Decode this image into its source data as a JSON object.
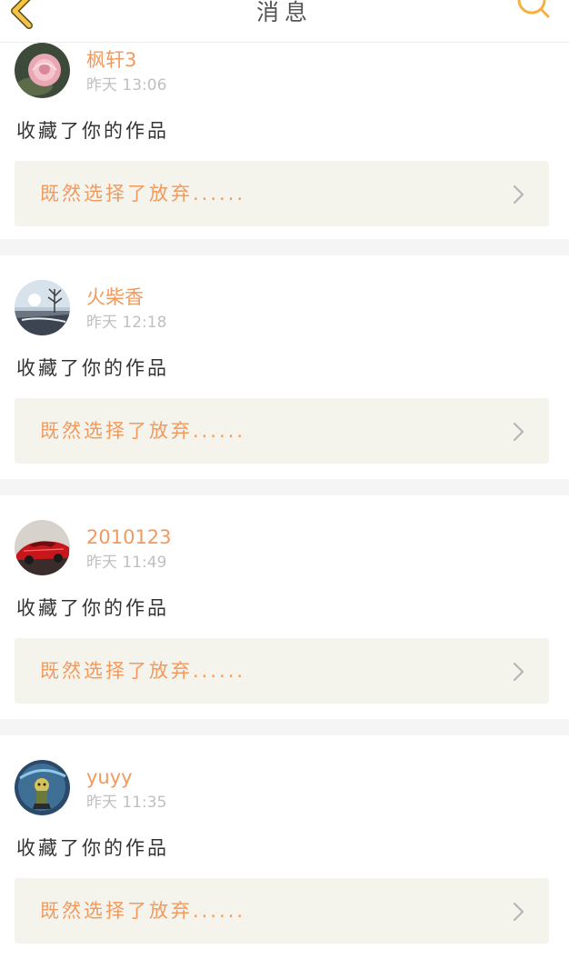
{
  "header": {
    "title": "消息",
    "back_icon": "chevron-left-icon",
    "search_icon": "search-icon",
    "accent_color": "#f5b041"
  },
  "colors": {
    "username": "#f29a5e",
    "quote_bg": "#f4f3ec",
    "divider": "#f5f5f5"
  },
  "messages": [
    {
      "avatar": "rose-avatar",
      "username": "枫轩3",
      "time": "昨天 13:06",
      "action": "收藏了你的作品",
      "quote": "既然选择了放弃......"
    },
    {
      "avatar": "winter-landscape-avatar",
      "username": "火柴香",
      "time": "昨天 12:18",
      "action": "收藏了你的作品",
      "quote": "既然选择了放弃......"
    },
    {
      "avatar": "red-car-avatar",
      "username": "2010123",
      "time": "昨天 11:49",
      "action": "收藏了你的作品",
      "quote": "既然选择了放弃......"
    },
    {
      "avatar": "figure-avatar",
      "username": "yuyy",
      "time": "昨天 11:35",
      "action": "收藏了你的作品",
      "quote": "既然选择了放弃......"
    }
  ]
}
